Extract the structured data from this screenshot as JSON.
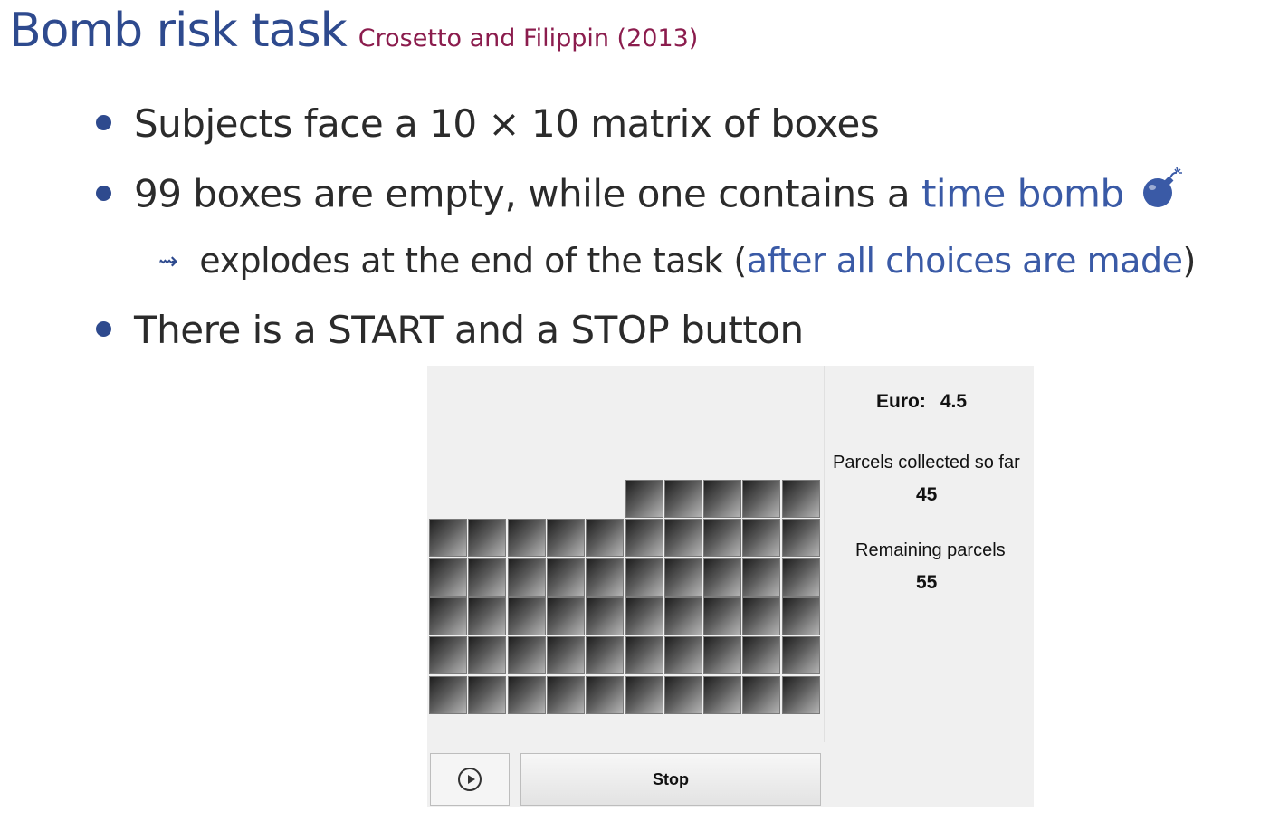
{
  "slide": {
    "title": "Bomb risk task",
    "citation": "Crosetto and Filippin (2013)"
  },
  "bullets": {
    "b1": "Subjects face a 10 × 10 matrix of boxes",
    "b2_prefix": "99 boxes are empty, while one contains a ",
    "b2_highlight": "time bomb",
    "sub_arrow": "⇝",
    "sub_prefix": "explodes at the end of the task (",
    "sub_highlight": "after all choices are made",
    "sub_suffix": ")",
    "b3": "There is a START and a STOP button"
  },
  "app": {
    "euro_label": "Euro:",
    "euro_value": "4.5",
    "collected_label": "Parcels collected so far",
    "collected_value": "45",
    "remaining_label": "Remaining parcels",
    "remaining_value": "55",
    "stop_label": "Stop",
    "grid": {
      "columns": 10,
      "rows_visible": 5,
      "top_partial_columns": 5
    }
  },
  "colors": {
    "title": "#2e4a8e",
    "citation": "#8b1c4d",
    "highlight": "#3a5aa6",
    "bullet": "#2e4a8e"
  },
  "icons": {
    "bomb": "bomb-icon",
    "play": "play-circle-icon",
    "arrow": "squiggle-arrow-icon"
  }
}
